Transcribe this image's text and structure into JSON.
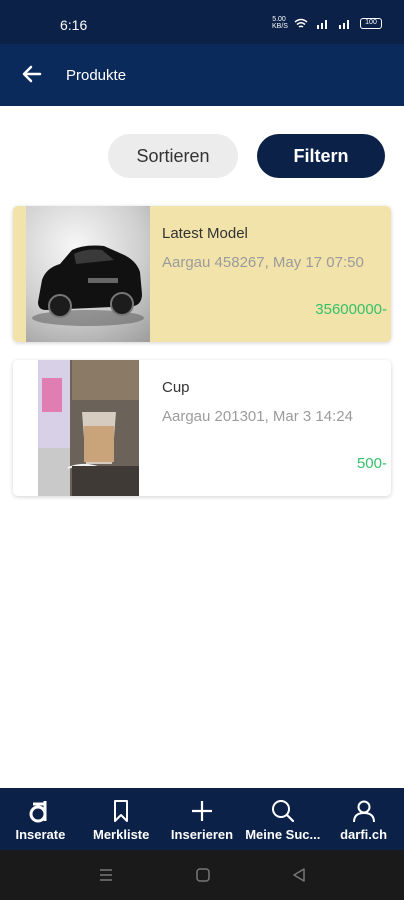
{
  "status_bar": {
    "time": "6:16",
    "network": "5.00 KB/S",
    "battery": "100"
  },
  "app_bar": {
    "title": "Produkte"
  },
  "actions": {
    "sort_label": "Sortieren",
    "filter_label": "Filtern"
  },
  "listings": [
    {
      "title": "Latest Model",
      "subtitle": "Aargau 458267, May 17 07:50",
      "price": "35600000-",
      "highlighted": true,
      "image": "black-sports-car"
    },
    {
      "title": "Cup",
      "subtitle": "Aargau 201301, Mar 3 14:24",
      "price": "500-",
      "highlighted": false,
      "image": "glass-cup-on-table"
    }
  ],
  "bottom_nav": {
    "items": [
      {
        "label": "Inserate",
        "icon": "d-logo-icon"
      },
      {
        "label": "Merkliste",
        "icon": "bookmark-icon"
      },
      {
        "label": "Inserieren",
        "icon": "plus-icon"
      },
      {
        "label": "Meine Suc...",
        "icon": "search-icon"
      },
      {
        "label": "darfi.ch",
        "icon": "user-icon"
      }
    ]
  },
  "colors": {
    "brand": "#0b2148",
    "highlight": "#f1e3aa",
    "price": "#36c06a"
  }
}
